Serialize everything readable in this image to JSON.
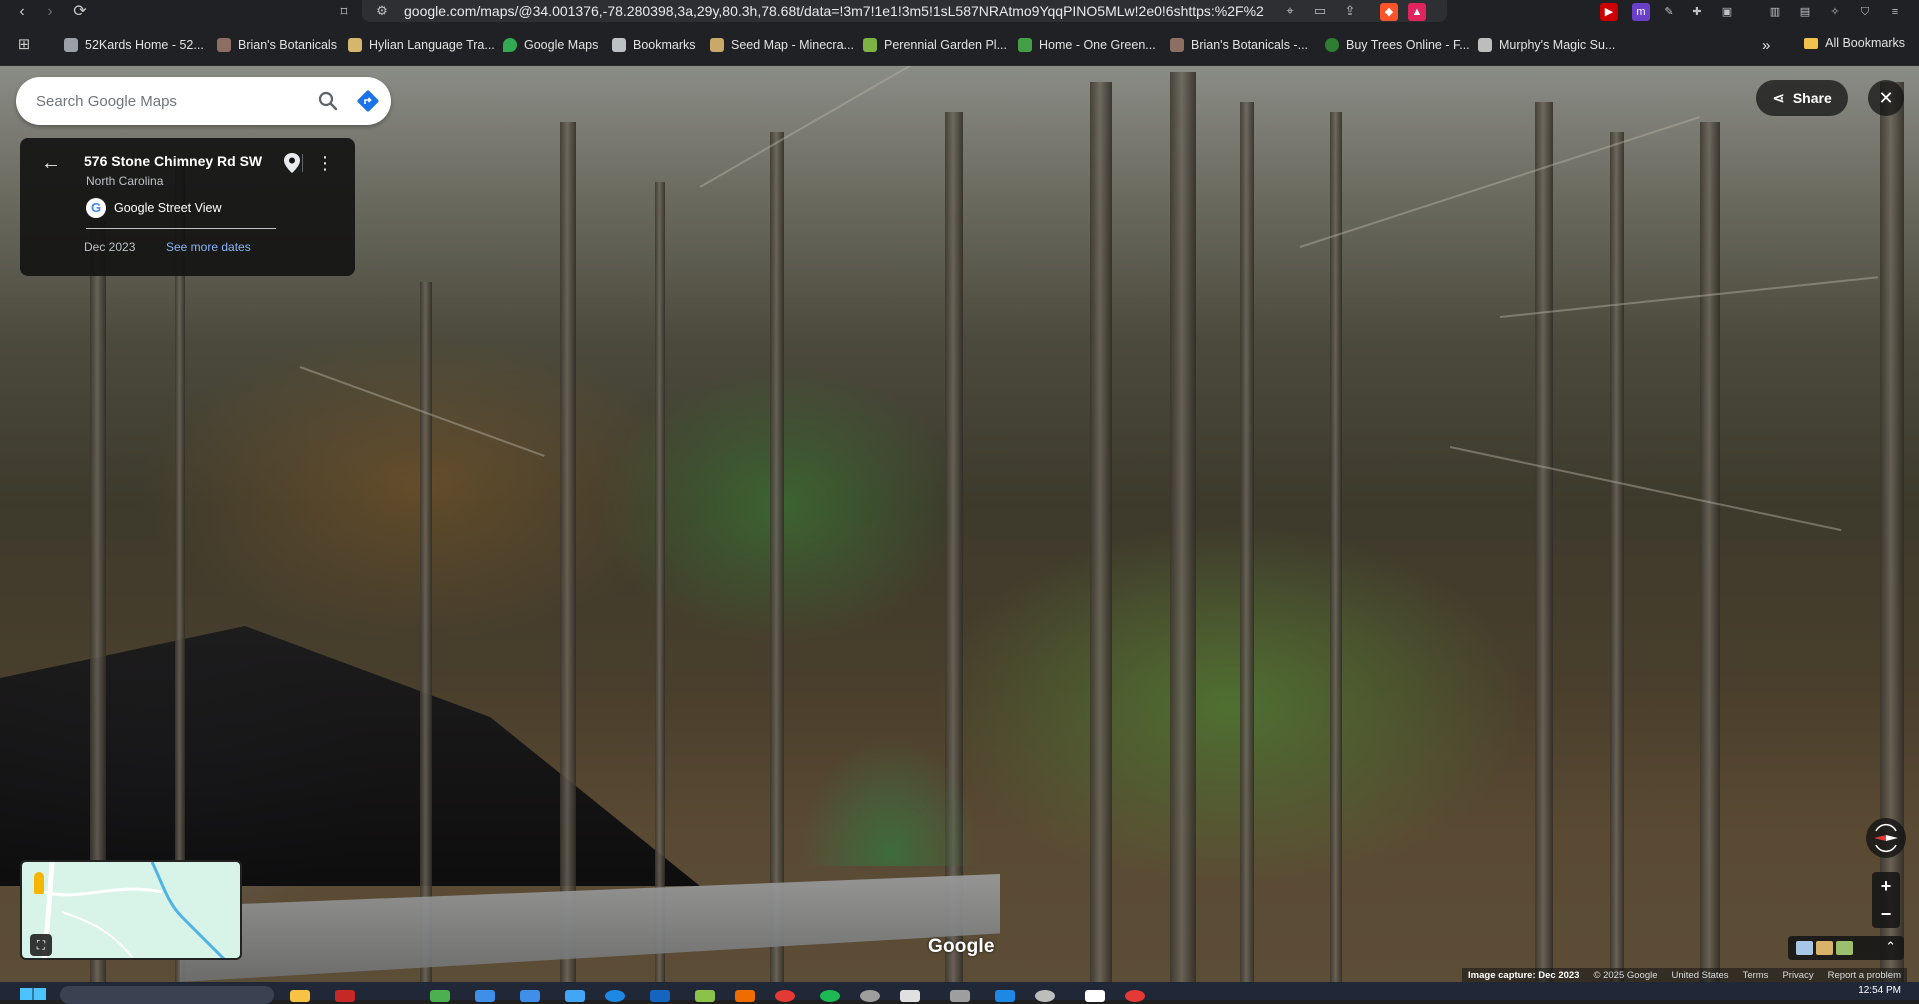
{
  "browser": {
    "url": "google.com/maps/@34.001376,-78.280398,3a,29y,80.3h,78.68t/data=!3m7!1e1!3m5!1sL587NRAtmo9YqqPINO5MLw!2e0!6shttps:%2F%2Fs...",
    "bookmarks": [
      {
        "label": "52Kards Home - 52...",
        "icon": "globe-icon",
        "color": "#9aa0a6"
      },
      {
        "label": "Brian's Botanicals",
        "icon": "botanicals-icon",
        "color": "#8d6e63"
      },
      {
        "label": "Hylian Language Tra...",
        "icon": "page-icon",
        "color": "#d7b56d"
      },
      {
        "label": "Google Maps",
        "icon": "maps-pin-icon",
        "color": "#34a853"
      },
      {
        "label": "Bookmarks",
        "icon": "bookmark-page-icon",
        "color": "#bdc1c6"
      },
      {
        "label": "Seed Map - Minecra...",
        "icon": "seed-map-icon",
        "color": "#c9a86a"
      },
      {
        "label": "Perennial Garden Pl...",
        "icon": "garden-icon",
        "color": "#7cb342"
      },
      {
        "label": "Home - One Green...",
        "icon": "leaf-icon",
        "color": "#43a047"
      },
      {
        "label": "Brian's Botanicals -...",
        "icon": "botanicals-icon",
        "color": "#8d6e63"
      },
      {
        "label": "Buy Trees Online - F...",
        "icon": "tree-icon",
        "color": "#2e7d32"
      },
      {
        "label": "Murphy's Magic Su...",
        "icon": "magic-icon",
        "color": "#bdbdbd"
      }
    ],
    "all_bookmarks": "All Bookmarks"
  },
  "maps": {
    "search": {
      "placeholder": "Search Google Maps"
    },
    "card": {
      "title": "576 Stone Chimney Rd SW",
      "subtitle": "North Carolina",
      "provider": "Google Street View",
      "date": "Dec 2023",
      "see_more": "See more dates"
    },
    "share_label": "Share",
    "logo": "Google",
    "attribution": {
      "capture": "Image capture: Dec 2023",
      "copyright": "© 2025 Google",
      "country": "United States",
      "terms": "Terms",
      "privacy": "Privacy",
      "report": "Report a problem"
    }
  },
  "taskbar": {
    "time": "12:54 PM"
  }
}
